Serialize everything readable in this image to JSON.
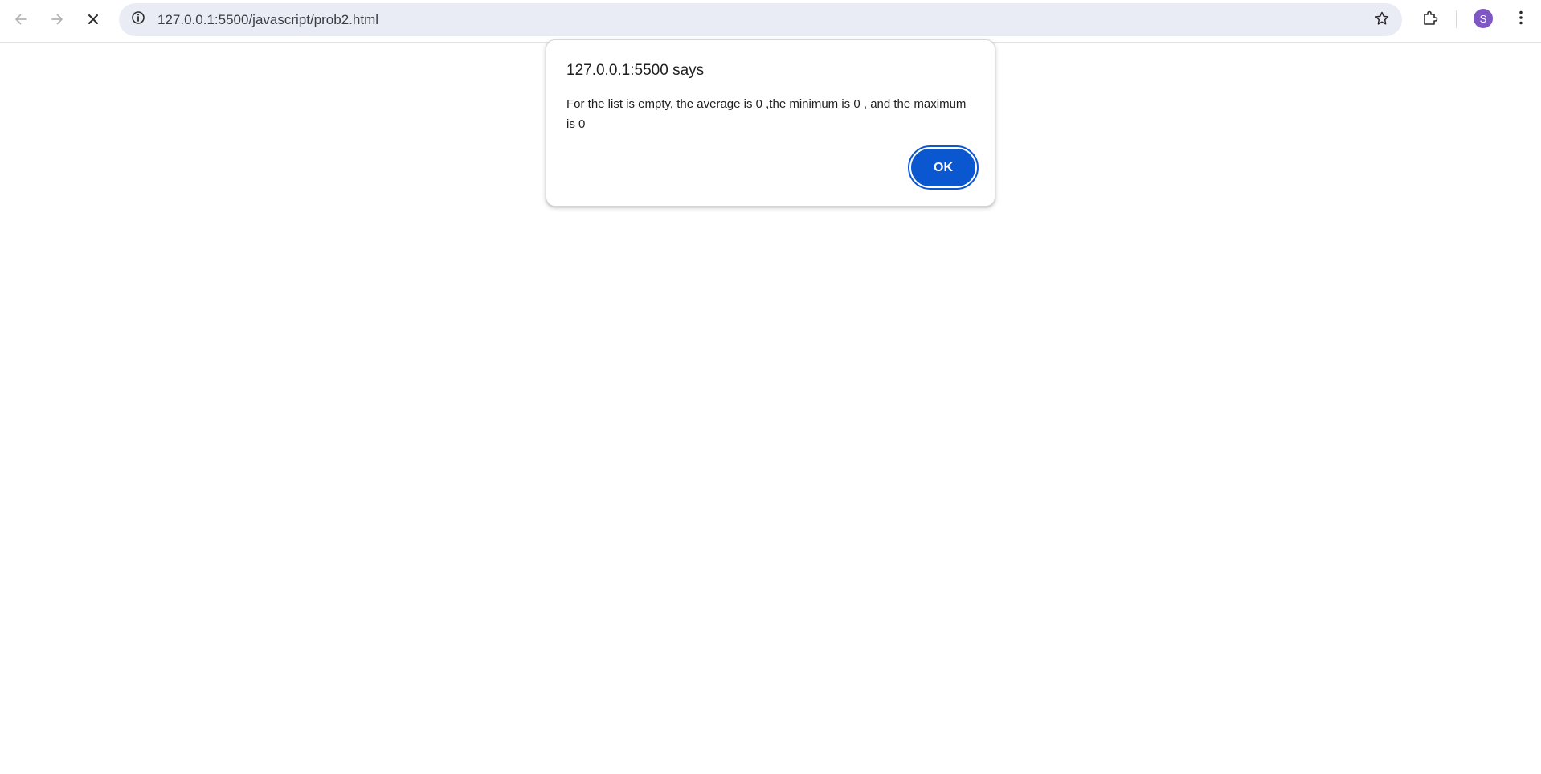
{
  "browser": {
    "url": "127.0.0.1:5500/javascript/prob2.html",
    "back_icon": "arrow-left-icon",
    "forward_icon": "arrow-right-icon",
    "stop_icon": "close-icon",
    "site_info_icon": "info-icon",
    "bookmark_icon": "star-icon",
    "extensions_icon": "puzzle-icon",
    "menu_icon": "more-vert-icon",
    "profile_initial": "S",
    "profile_color": "#7e57c2"
  },
  "dialog": {
    "title": "127.0.0.1:5500 says",
    "message": "For the list is empty, the average is 0 ,the minimum is 0 , and the maximum is 0",
    "ok_label": "OK",
    "accent_color": "#0b57d0"
  }
}
